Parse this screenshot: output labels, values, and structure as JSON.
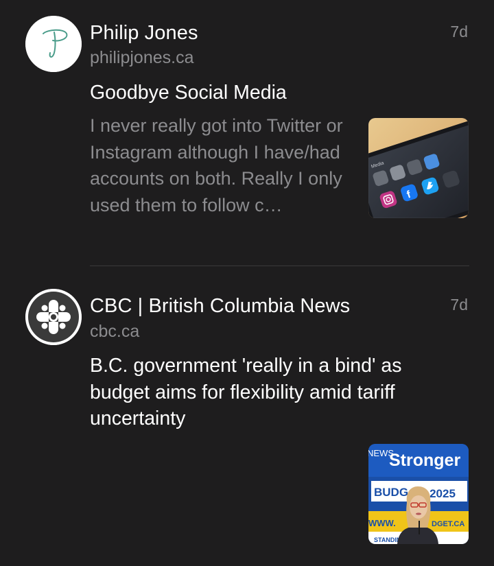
{
  "feed": {
    "items": [
      {
        "source_name": "Philip Jones",
        "source_domain": "philipjones.ca",
        "timestamp": "7d",
        "avatar_icon": "handwritten-p-logo",
        "title": "Goodbye Social Media",
        "excerpt": "I never really got into Twitter or Instagram although I have/had accounts on both. Really I only used them to follow c…",
        "thumbnail": {
          "icon": "phone-social-apps-photo",
          "app_labels": [
            "Facebook",
            "Twitter",
            "Instagram"
          ]
        }
      },
      {
        "source_name": "CBC | British Columbia News",
        "source_domain": "cbc.ca",
        "timestamp": "7d",
        "avatar_icon": "cbc-gem-logo",
        "title": "B.C. government 'really in a bind' as budget aims for flexibility amid tariff uncertainty",
        "thumbnail": {
          "icon": "budget-speech-photo",
          "signage_text": [
            "NEWS",
            "Stronger",
            "BUDG",
            "T 2025",
            "WWW.",
            "DGET.CA",
            "STANDING STRONG"
          ]
        }
      }
    ]
  },
  "colors": {
    "background": "#1e1d1e",
    "primary_text": "#ffffff",
    "secondary_text": "#8c8c8f",
    "divider": "#3a393b",
    "logo_stroke": "#4a9c8a",
    "cbc_logo_bg": "#3a3a3a"
  }
}
